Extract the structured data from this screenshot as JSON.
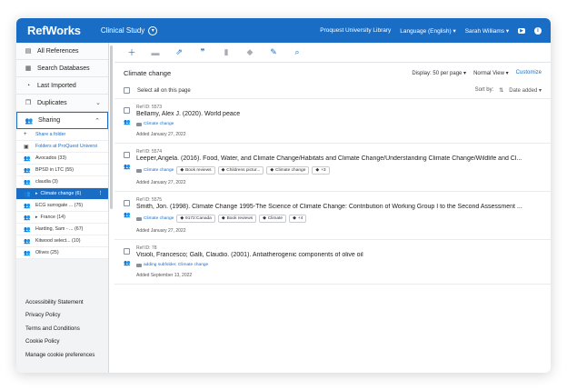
{
  "app": {
    "logo": "RefWorks",
    "project": "Clinical Study",
    "library": "Proquest University Library",
    "language": "Language (English) ▾",
    "user": "Sarah Williams ▾"
  },
  "sidebar": {
    "items": [
      {
        "label": "All References"
      },
      {
        "label": "Search Databases"
      },
      {
        "label": "Last Imported"
      },
      {
        "label": "Duplicates"
      },
      {
        "label": "Sharing"
      }
    ],
    "share_folder": "Share a folder",
    "folders_at": "Folders at ProQuest Universi",
    "folders": [
      {
        "label": "Avocados (33)"
      },
      {
        "label": "BPSD in LTC (55)"
      },
      {
        "label": "claudia (3)"
      },
      {
        "label": "Climate change (6)"
      },
      {
        "label": "ECG surrogate ... (75)"
      },
      {
        "label": "France (14)"
      },
      {
        "label": "Harding, Sam - ... (67)"
      },
      {
        "label": "Kitwood select... (10)"
      },
      {
        "label": "Olives (25)"
      }
    ],
    "footer": [
      "Accessibility Statement",
      "Privacy Policy",
      "Terms and Conditions",
      "Cookie Policy",
      "Manage cookie preferences"
    ]
  },
  "main": {
    "title": "Climate change",
    "display_label": "Display:",
    "per_page": "50 per page ▾",
    "view": "Normal View ▾",
    "customize": "Customize",
    "select_all": "Select all on this page",
    "sort_by": "Sort by:",
    "sort_value": "Date added ▾"
  },
  "references": [
    {
      "id": "Ref ID: 5573",
      "title": "Bellamy, Alex J. (2020). World peace",
      "folder": "Climate change",
      "tags": [],
      "added": "Added January 27, 2022"
    },
    {
      "id": "Ref ID: 5574",
      "title": "Leeper,Angela. (2016). Food, Water, and Climate Change/Habitats and Climate Change/Understanding Climate Change/Wildlife and Cl...",
      "folder": "Climate change",
      "tags": [
        "Book reviews",
        "Childrens pictur...",
        "Climate change",
        "+3"
      ],
      "added": "Added January 27, 2022"
    },
    {
      "id": "Ref ID: 5575",
      "title": "Smith, Jon. (1998). Climate Change 1995-The Science of Climate Change: Contribution of Working Group I to the Second Assessment ...",
      "folder": "Climate change",
      "tags": [
        "9172:Canada",
        "Book reviews",
        "Climate",
        "+4"
      ],
      "added": "Added January 27, 2022"
    },
    {
      "id": "Ref ID: 78",
      "title": "Visioli, Francesco; Galli, Claudio. (2001). Antiatherogenic components of olive oil",
      "folder": "adding subfolder, Climate change",
      "tags": [],
      "added": "Added September 13, 2022"
    }
  ]
}
